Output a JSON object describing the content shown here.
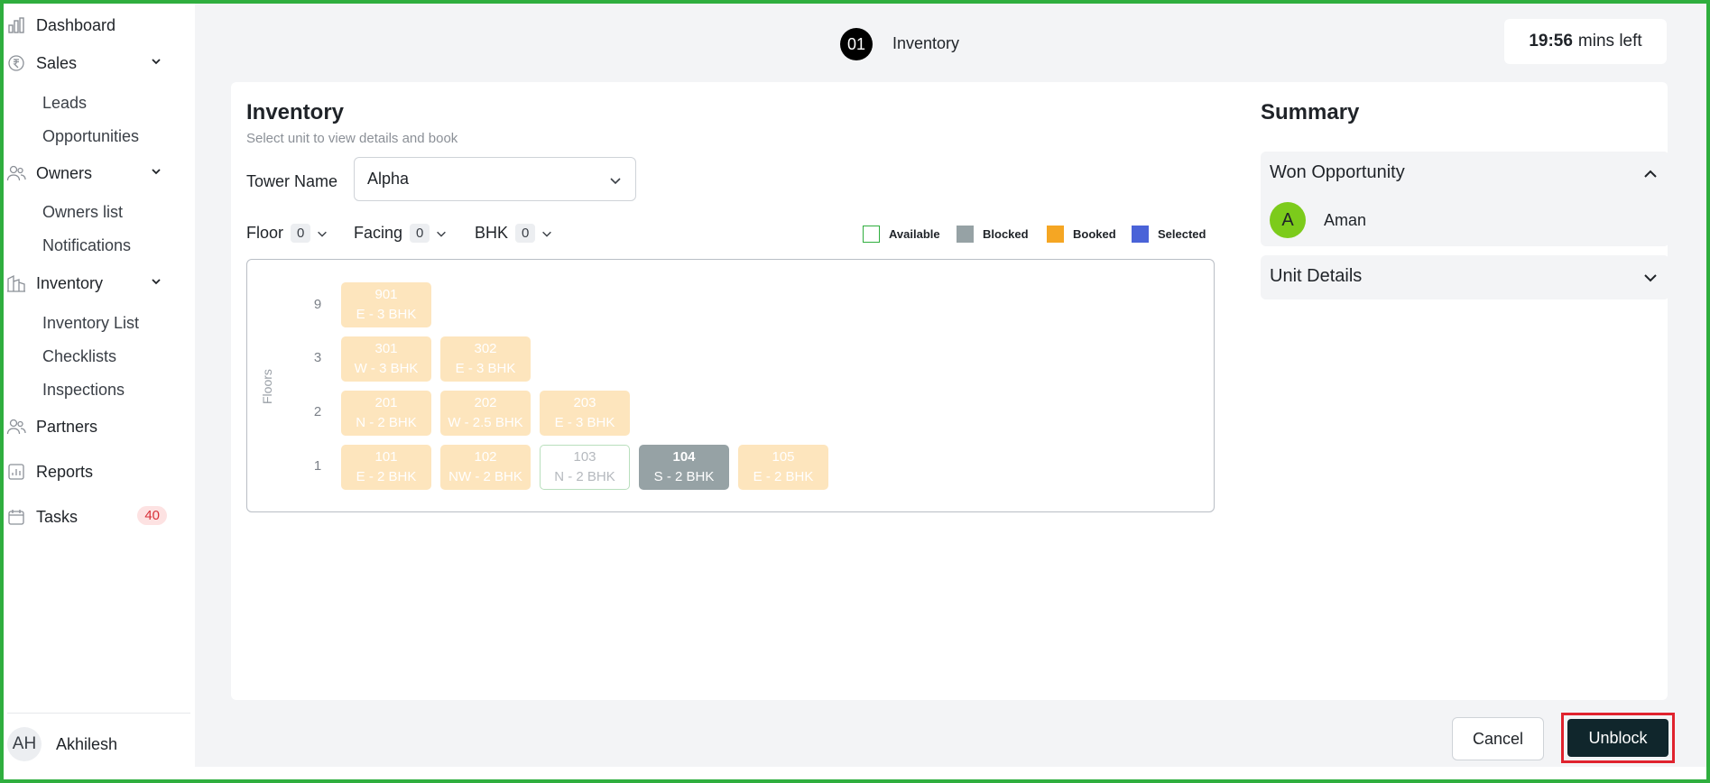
{
  "sidebar": {
    "dashboard": "Dashboard",
    "sales": "Sales",
    "sales_items": [
      "Leads",
      "Opportunities"
    ],
    "owners": "Owners",
    "owners_items": [
      "Owners list",
      "Notifications"
    ],
    "inventory": "Inventory",
    "inventory_items": [
      "Inventory List",
      "Checklists",
      "Inspections"
    ],
    "partners": "Partners",
    "reports": "Reports",
    "tasks": "Tasks",
    "tasks_badge": "40",
    "user_initials": "AH",
    "user_name": "Akhilesh"
  },
  "header": {
    "step_number": "01",
    "step_label": "Inventory",
    "timer_value": "19:56",
    "timer_suffix": "mins left"
  },
  "inventory": {
    "title": "Inventory",
    "subtitle": "Select unit to view details and book",
    "tower_label": "Tower Name",
    "tower_value": "Alpha",
    "filters": {
      "floor": "Floor",
      "floor_count": "0",
      "facing": "Facing",
      "facing_count": "0",
      "bhk": "BHK",
      "bhk_count": "0"
    },
    "legend": {
      "available": "Available",
      "blocked": "Blocked",
      "booked": "Booked",
      "selected": "Selected",
      "colors": {
        "available": "#2fae3e",
        "blocked": "#96a2a5",
        "booked": "#f5a623",
        "selected": "#4a63d8"
      }
    },
    "axis_label": "Floors",
    "floors": [
      "9",
      "3",
      "2",
      "1"
    ],
    "units": {
      "u901": {
        "num": "901",
        "desc": "E - 3 BHK",
        "status": "booked"
      },
      "u301": {
        "num": "301",
        "desc": "W - 3 BHK",
        "status": "booked"
      },
      "u302": {
        "num": "302",
        "desc": "E - 3 BHK",
        "status": "booked"
      },
      "u201": {
        "num": "201",
        "desc": "N - 2 BHK",
        "status": "booked"
      },
      "u202": {
        "num": "202",
        "desc": "W - 2.5 BHK",
        "status": "booked"
      },
      "u203": {
        "num": "203",
        "desc": "E - 3 BHK",
        "status": "booked"
      },
      "u101": {
        "num": "101",
        "desc": "E - 2 BHK",
        "status": "booked"
      },
      "u102": {
        "num": "102",
        "desc": "NW - 2 BHK",
        "status": "booked"
      },
      "u103": {
        "num": "103",
        "desc": "N - 2 BHK",
        "status": "available"
      },
      "u104": {
        "num": "104",
        "desc": "S - 2 BHK",
        "status": "blocked"
      },
      "u105": {
        "num": "105",
        "desc": "E - 2 BHK",
        "status": "booked"
      }
    }
  },
  "summary": {
    "title": "Summary",
    "won_opportunity": "Won Opportunity",
    "contact_initial": "A",
    "contact_name": "Aman",
    "unit_details": "Unit Details"
  },
  "actions": {
    "cancel": "Cancel",
    "unblock": "Unblock"
  }
}
